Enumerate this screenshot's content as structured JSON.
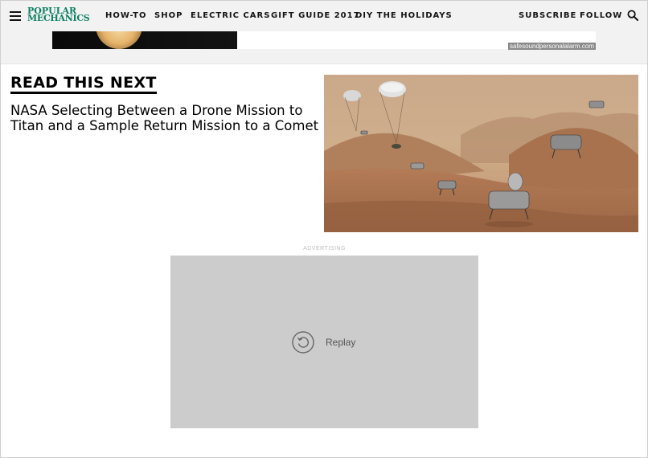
{
  "header": {
    "logo_line1": "POPULAR",
    "logo_line2": "MECHANICS",
    "nav": [
      "HOW-TO",
      "SHOP",
      "ELECTRIC CARS",
      "GIFT GUIDE 2017",
      "DIY THE HOLIDAYS"
    ],
    "subscribe": "SUBSCRIBE",
    "follow": "FOLLOW",
    "menu_icon": "hamburger-menu-icon",
    "search_icon": "search-icon"
  },
  "ad_banner": {
    "url_text": "safesoundpersonalalarm.com"
  },
  "read_next": {
    "heading": "READ THIS NEXT",
    "headline": "NASA Selecting Between a Drone Mission to Titan and a Sample Return Mission to a Comet"
  },
  "video_ad": {
    "label": "ADVERTISING",
    "replay": "Replay",
    "replay_icon": "replay-icon"
  },
  "colors": {
    "brand_green": "#0c7f63",
    "header_bg": "#f2f2f2",
    "player_bg": "#cccccc"
  }
}
